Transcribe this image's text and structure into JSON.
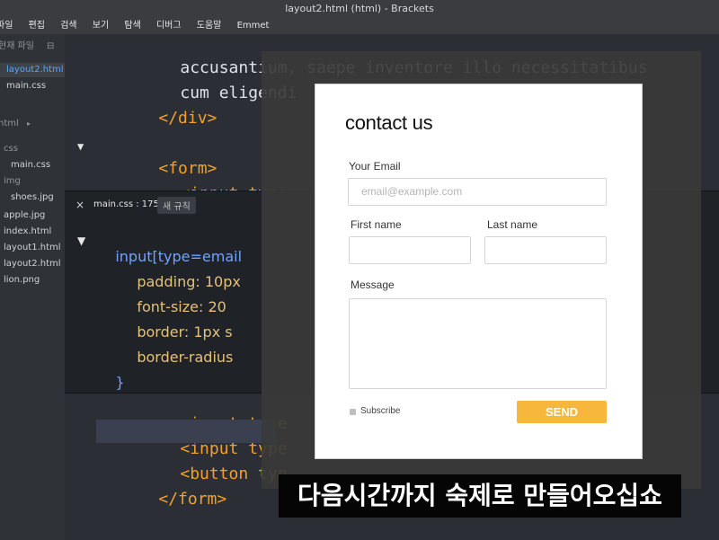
{
  "window": {
    "title": "layout2.html (html) - Brackets"
  },
  "menu": {
    "items": [
      "파일",
      "편집",
      "검색",
      "보기",
      "탐색",
      "디버그",
      "도움말",
      "Emmet"
    ]
  },
  "sidebar": {
    "working_files_header": "현재 파일",
    "working_files": [
      {
        "label": "layout2.html",
        "active": true
      },
      {
        "label": "main.css",
        "active": false
      }
    ],
    "project_root": "html",
    "tree": [
      {
        "label": "css"
      },
      {
        "label": "main.css"
      },
      {
        "label": "img"
      },
      {
        "label": "shoes.jpg"
      },
      {
        "label": "apple.jpg"
      },
      {
        "label": "index.html"
      },
      {
        "label": "layout1.html"
      },
      {
        "label": "layout2.html"
      },
      {
        "label": "lion.png"
      }
    ]
  },
  "editor": {
    "top_lines": [
      "accusantium, saepe inventore illo necessitatibus",
      "cum eligendi",
      "</div>",
      "",
      "<form>",
      "<input type"
    ],
    "inline": {
      "file_label": "main.css : 175",
      "badge": "새 규칙",
      "lines": [
        "input[type=email",
        "padding: 10px",
        "font-size: 20",
        "border: 1px s",
        "border-radius",
        "}"
      ]
    },
    "bottom_lines": [
      "<input type",
      "<input type",
      "<button typ",
      "</form>"
    ]
  },
  "preview": {
    "title": "contact us",
    "email_label": "Your Email",
    "email_placeholder": "email@example.com",
    "first_name_label": "First name",
    "last_name_label": "Last name",
    "message_label": "Message",
    "subscribe_label": "Subscribe",
    "send_label": "SEND",
    "colors": {
      "send_bg": "#f6b73c"
    }
  },
  "subtitle": {
    "text": "다음시간까지 숙제로 만들어오십쇼"
  }
}
